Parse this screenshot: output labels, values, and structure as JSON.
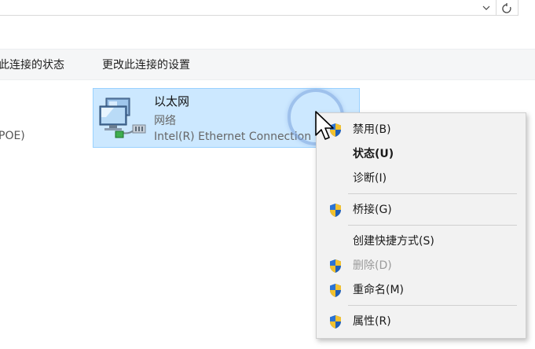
{
  "address_bar": {
    "dropdown_glyph": "⌄",
    "refresh_glyph": "↻"
  },
  "command_bar": {
    "view_status": "此连接的状态",
    "change_settings": "更改此连接的设置"
  },
  "left_item": {
    "partial_text": "POE)"
  },
  "connection": {
    "name": "以太网",
    "type": "网络",
    "device": "Intel(R) Ethernet Connection"
  },
  "context_menu": {
    "items": [
      {
        "label": "禁用(B)",
        "icon": "uac-shield-icon"
      },
      {
        "label": "状态(U)",
        "icon": null,
        "bold": true
      },
      {
        "label": "诊断(I)",
        "icon": null
      },
      {
        "label": "桥接(G)",
        "icon": "uac-shield-icon"
      },
      {
        "label": "创建快捷方式(S)",
        "icon": null
      },
      {
        "label": "删除(D)",
        "icon": "uac-shield-icon",
        "disabled": true
      },
      {
        "label": "重命名(M)",
        "icon": "uac-shield-icon"
      },
      {
        "label": "属性(R)",
        "icon": "uac-shield-icon"
      }
    ]
  },
  "colors": {
    "selection_fill": "#cce8ff",
    "selection_border": "#99d1ff",
    "menu_background": "#f2f2f2"
  }
}
